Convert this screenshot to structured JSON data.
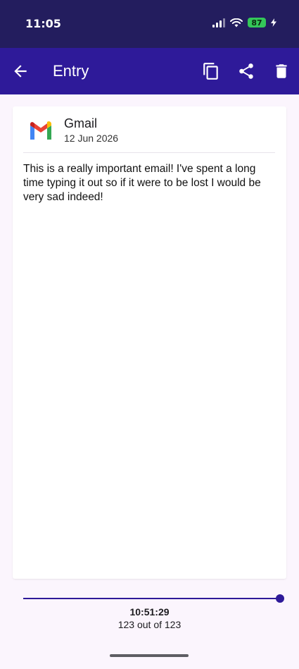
{
  "status_bar": {
    "time": "11:05",
    "battery": "87",
    "battery_color": "#34c759"
  },
  "app_bar": {
    "title": "Entry",
    "back_icon": "arrow-left-icon",
    "actions": [
      "copy-icon",
      "share-icon",
      "delete-icon"
    ],
    "color": "#2e1a99"
  },
  "entry": {
    "app_name": "Gmail",
    "app_icon": "gmail-icon",
    "date": "12 Jun 2026",
    "body": "This is a really important email! I've spent a long time typing it out so if it were to be lost I would be very sad indeed!"
  },
  "history": {
    "timestamp": "10:51:29",
    "position_text": "123 out of 123",
    "current": 123,
    "total": 123
  }
}
